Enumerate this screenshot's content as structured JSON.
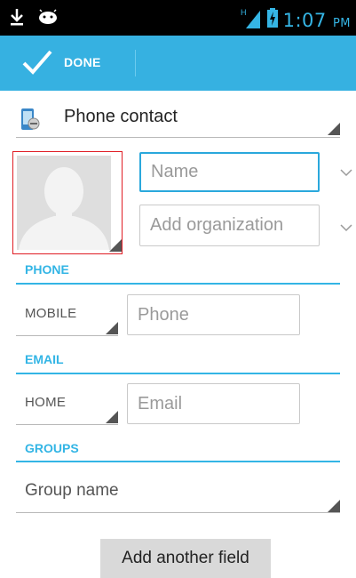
{
  "status_bar": {
    "time": "1:07",
    "ampm": "PM",
    "network_type": "H",
    "icons": [
      "download-icon",
      "android-icon",
      "signal-icon",
      "battery-charging-icon"
    ]
  },
  "action_bar": {
    "done_label": "DONE",
    "accent_color": "#36b1e1"
  },
  "account": {
    "label": "Phone contact",
    "icon": "phone-contact-icon"
  },
  "name_field": {
    "placeholder": "Name"
  },
  "organization_field": {
    "placeholder": "Add organization"
  },
  "sections": {
    "phone": {
      "title": "PHONE",
      "type": "MOBILE",
      "placeholder": "Phone"
    },
    "email": {
      "title": "EMAIL",
      "type": "HOME",
      "placeholder": "Email"
    },
    "groups": {
      "title": "GROUPS",
      "value": "Group name"
    }
  },
  "add_field_button": "Add another field"
}
